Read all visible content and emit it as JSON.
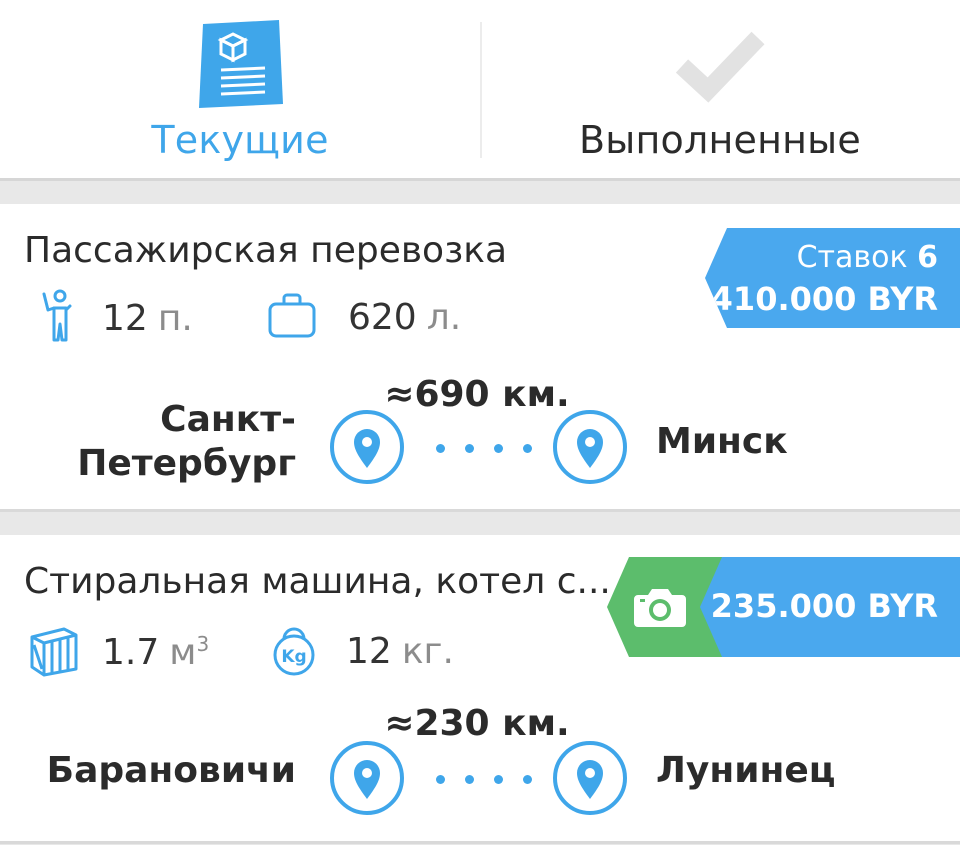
{
  "tabs": {
    "current_label": "Текущие",
    "done_label": "Выполненные"
  },
  "colors": {
    "accent": "#3fa6ea",
    "badge": "#4aa8ee",
    "photo_badge": "#5cbd6c",
    "text": "#2b2b2b",
    "muted": "#8c8c8c"
  },
  "orders": [
    {
      "title": "Пассажирская перевозка",
      "stat1": {
        "icon": "passenger-icon",
        "value": "12",
        "unit": "п."
      },
      "stat2": {
        "icon": "luggage-icon",
        "value": "620",
        "unit": "л."
      },
      "bids_label": "Ставок",
      "bids_count": "6",
      "price": "410.000 BYR",
      "distance": "≈690 км.",
      "from_line1": "Санкт-",
      "from_line2": "Петербург",
      "to": "Минск"
    },
    {
      "title": "Стиральная машина, котел с...",
      "stat1": {
        "icon": "volume-box-icon",
        "value": "1.7",
        "unit": "м",
        "unit_sup": "3"
      },
      "stat2": {
        "icon": "weight-kg-icon",
        "value": "12",
        "unit": "кг.",
        "icon_text": "Kg"
      },
      "has_photo": true,
      "price": "235.000 BYR",
      "distance": "≈230 км.",
      "from": "Барановичи",
      "to": "Лунинец"
    }
  ]
}
